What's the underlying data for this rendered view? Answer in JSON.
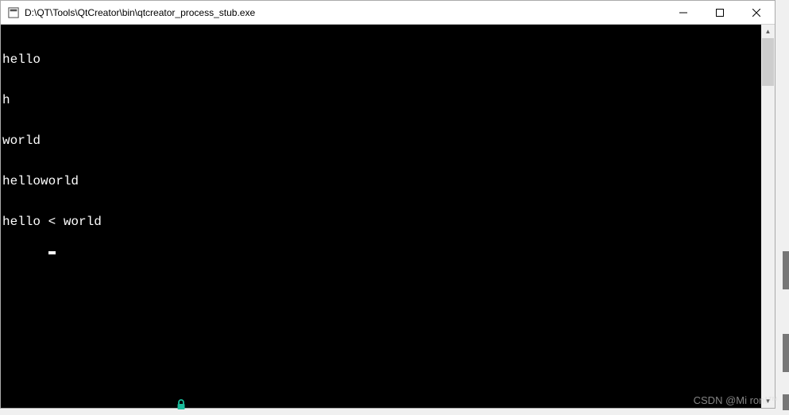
{
  "window": {
    "title": "D:\\QT\\Tools\\QtCreator\\bin\\qtcreator_process_stub.exe"
  },
  "console": {
    "lines": [
      "hello",
      "h",
      "world",
      "helloworld",
      "hello < world"
    ]
  },
  "watermark": "CSDN @Mi ronI™"
}
